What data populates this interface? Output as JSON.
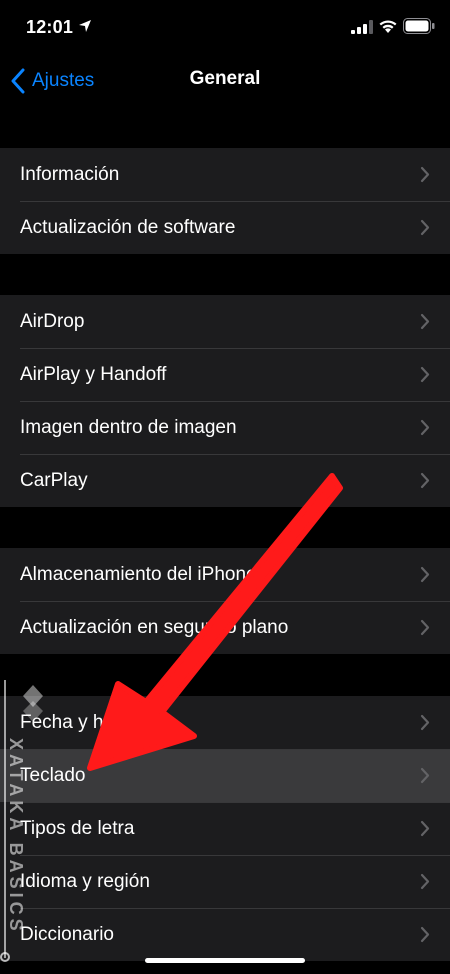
{
  "status": {
    "time": "12:01"
  },
  "nav": {
    "back_label": "Ajustes",
    "title": "General"
  },
  "groups": [
    {
      "items": [
        {
          "label": "Información"
        },
        {
          "label": "Actualización de software"
        }
      ]
    },
    {
      "items": [
        {
          "label": "AirDrop"
        },
        {
          "label": "AirPlay y Handoff"
        },
        {
          "label": "Imagen dentro de imagen"
        },
        {
          "label": "CarPlay"
        }
      ]
    },
    {
      "items": [
        {
          "label": "Almacenamiento del iPhone"
        },
        {
          "label": "Actualización en segundo plano"
        }
      ]
    },
    {
      "items": [
        {
          "label": "Fecha y hora"
        },
        {
          "label": "Teclado",
          "selected": true
        },
        {
          "label": "Tipos de letra"
        },
        {
          "label": "Idioma y región"
        },
        {
          "label": "Diccionario"
        }
      ]
    }
  ],
  "watermark": {
    "text": "XATAKA BASICS"
  },
  "colors": {
    "accent": "#0a84ff",
    "arrow": "#ff1a1a",
    "cell": "#1c1c1e",
    "selected_cell": "#3a3a3c"
  }
}
